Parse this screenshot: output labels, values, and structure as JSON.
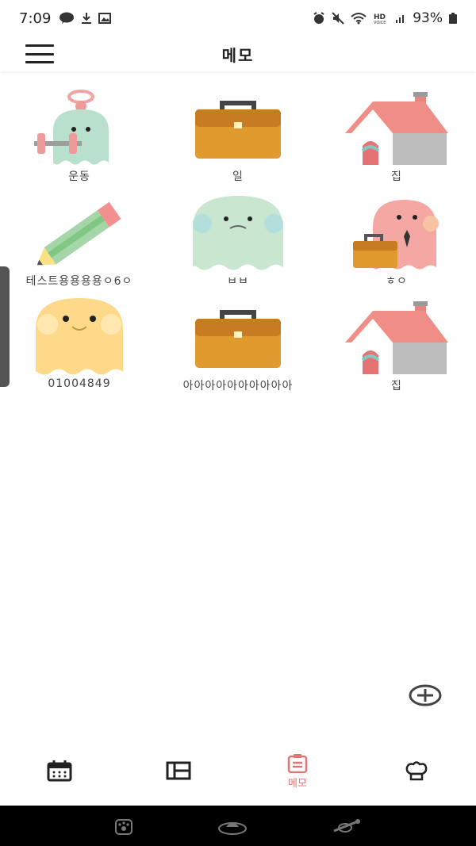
{
  "status_bar": {
    "time": "7:09",
    "left_icons": [
      "talk-icon",
      "download-icon",
      "image-icon"
    ],
    "right_icons": [
      "alarm-icon",
      "mute-icon",
      "wifi-icon",
      "hd-voice-icon",
      "signal-icon"
    ],
    "battery_text": "93%"
  },
  "header": {
    "title": "메모"
  },
  "memos": [
    {
      "label": "운동",
      "icon": "ghost-dumbbell-icon"
    },
    {
      "label": "일",
      "icon": "briefcase-icon"
    },
    {
      "label": "집",
      "icon": "house-icon"
    },
    {
      "label": "테스트용용용용ㅇ6ㅇ",
      "icon": "pencil-icon"
    },
    {
      "label": "ㅂㅂ",
      "icon": "ghost-mint-icon"
    },
    {
      "label": "ㅎㅇ",
      "icon": "ghost-briefcase-icon"
    },
    {
      "label": "01004849",
      "icon": "ghost-yellow-icon"
    },
    {
      "label": "아아아아아아아아아아",
      "icon": "briefcase-icon"
    },
    {
      "label": "집",
      "icon": "house-icon"
    }
  ],
  "bottom_nav": {
    "items": [
      {
        "name": "calendar",
        "icon": "calendar-icon",
        "label": ""
      },
      {
        "name": "board",
        "icon": "layout-icon",
        "label": ""
      },
      {
        "name": "memo",
        "icon": "clipboard-icon",
        "label": "메모"
      },
      {
        "name": "chef",
        "icon": "chef-hat-icon",
        "label": ""
      }
    ]
  },
  "colors": {
    "accent": "#e57373",
    "text": "#222222"
  }
}
